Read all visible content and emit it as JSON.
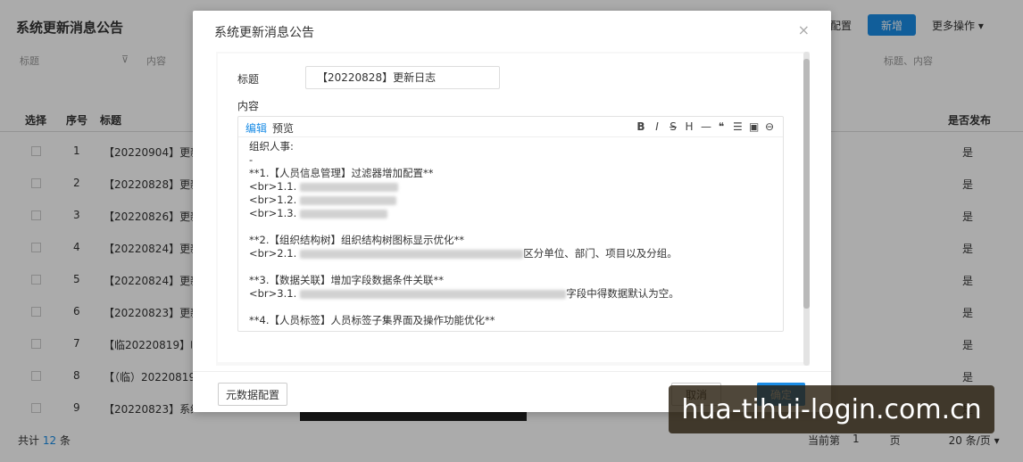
{
  "background": {
    "page_title": "系统更新消息公告",
    "toolbar": {
      "config_label": "配置",
      "new_label": "新增",
      "more_label": "更多操作",
      "more_icon": "▾"
    },
    "filter": {
      "field1": "标题",
      "field2": "内容",
      "filter_icon": "⊽",
      "right_placeholder": "标题、内容"
    },
    "table": {
      "headers": {
        "select": "选择",
        "index": "序号",
        "title": "标题",
        "published": "是否发布"
      },
      "rows": [
        {
          "index": "1",
          "title": "【20220904】更新日志",
          "published": "是"
        },
        {
          "index": "2",
          "title": "【20220828】更新日志",
          "published": "是"
        },
        {
          "index": "3",
          "title": "【20220826】更新日志",
          "published": "是"
        },
        {
          "index": "4",
          "title": "【20220824】更新日志",
          "published": "是"
        },
        {
          "index": "5",
          "title": "【20220824】更新日志",
          "published": "是"
        },
        {
          "index": "6",
          "title": "【20220823】更新日志",
          "published": "是"
        },
        {
          "index": "7",
          "title": "【临20220819】临时",
          "published": "是"
        },
        {
          "index": "8",
          "title": "【（临）20220819】",
          "published": "是"
        },
        {
          "index": "9",
          "title": "【20220823】系统更",
          "published": "是"
        }
      ]
    },
    "footer": {
      "total_prefix": "共计",
      "total_count": "12",
      "total_suffix": "条",
      "page_prefix": "当前第",
      "page_num": "1",
      "page_suffix": "页",
      "per_page": "20 条/页 ▾"
    }
  },
  "modal": {
    "title": "系统更新消息公告",
    "close_icon": "×",
    "form": {
      "title_label": "标题",
      "title_value": "【20220828】更新日志",
      "content_label": "内容"
    },
    "editor": {
      "tab_edit": "编辑",
      "tab_preview": "预览",
      "tools": [
        "B",
        "I",
        "S",
        "H",
        "—",
        "❝",
        "☰",
        "▣",
        "⊖"
      ],
      "lines": [
        "组织人事:",
        "-",
        "**1.【人员信息管理】过滤器增加配置**",
        "<br>1.1.",
        "<br>1.2.",
        "<br>1.3.",
        "",
        "**2.【组织结构树】组织结构树图标显示优化**",
        "<br>2.1.",
        "",
        "**3.【数据关联】增加字段数据条件关联**",
        "<br>3.1.",
        "",
        "**4.【人员标签】人员标签子集界面及操作功能优化**"
      ],
      "line_2_1_tail": "区分单位、部门、项目以及分组。",
      "line_3_1_tail": "字段中得数据默认为空。"
    },
    "buttons": {
      "meta": "元数据配置",
      "cancel": "取消",
      "ok": "确定"
    }
  },
  "watermark": "hua-tihui-login.com.cn",
  "colors": {
    "primary": "#1a8ce6",
    "overlay": "rgba(0,0,0,0.33)"
  }
}
